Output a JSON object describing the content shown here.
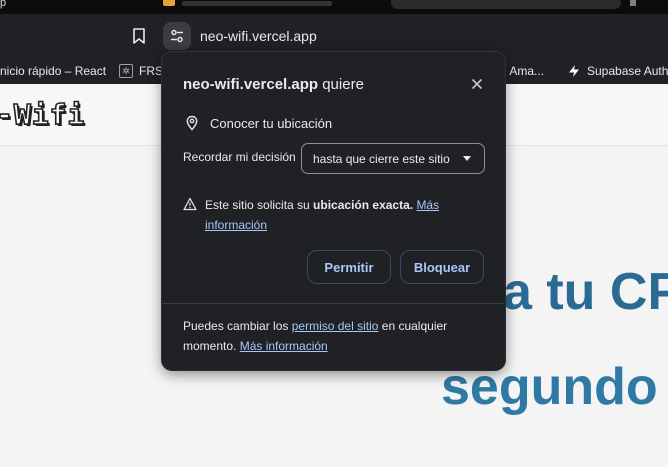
{
  "browser": {
    "tab_fragment": "p",
    "url": "neo-wifi.vercel.app"
  },
  "bookmarks": [
    {
      "label": "nicio rápido – React",
      "icon": "react-icon"
    },
    {
      "label": "FRSI",
      "icon": "frsi-icon"
    },
    {
      "label": "e Ama...",
      "icon": "amazon-icon"
    },
    {
      "label": "Supabase Auth",
      "icon": "supabase-icon"
    }
  ],
  "page": {
    "logo": "-Wifi",
    "hero_line1": "a tu CP",
    "hero_line2": "segundo"
  },
  "permission_popup": {
    "title_site": "neo-wifi.vercel.app",
    "title_suffix": " quiere",
    "permission_label": "Conocer tu ubicación",
    "remember_label": "Recordar mi decisión",
    "remember_selected": "hasta que cierre este sitio",
    "warning_prefix": "Este sitio solicita su ",
    "warning_bold": "ubicación exacta.",
    "warning_link": "Más información",
    "allow_label": "Permitir",
    "block_label": "Bloquear",
    "footer_prefix": "Puedes cambiar los ",
    "footer_link1": "permiso del sitio",
    "footer_middle": " en cualquier momento. ",
    "footer_link2": "Más información"
  },
  "colors": {
    "popup_bg": "#202124",
    "link": "#a8c7fa",
    "hero": "#2a6a93"
  }
}
